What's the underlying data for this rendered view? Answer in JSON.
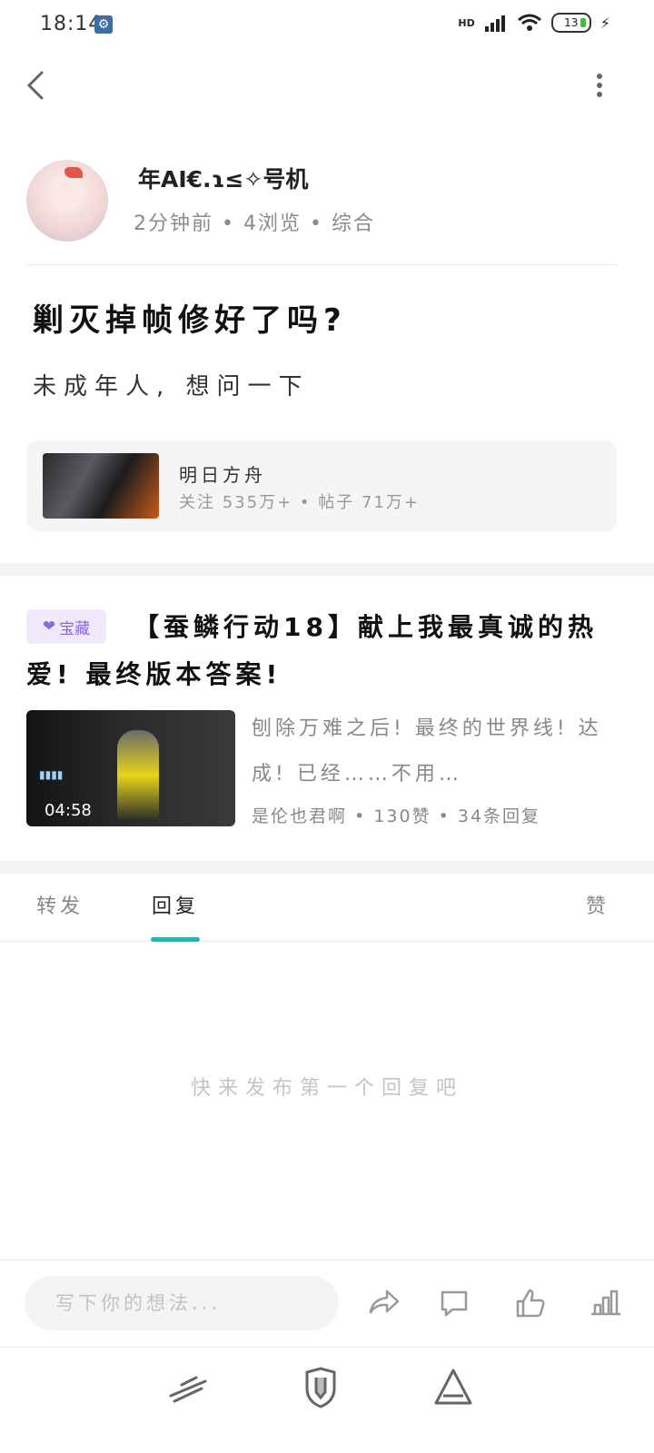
{
  "status_bar": {
    "time": "18:14",
    "network": "HD",
    "battery": "13"
  },
  "post": {
    "author": "年AI€.ɿ≤✧号机",
    "time_ago": "2分钟前",
    "views": "4浏览",
    "category": "综合",
    "title": "剿灭掉帧修好了吗?",
    "body": "未成年人, 想问一下"
  },
  "forum": {
    "name": "明日方舟",
    "followers": "关注 535万+",
    "posts": "帖子 71万+"
  },
  "related": {
    "badge": "宝藏",
    "title": "【蚕鳞行动18】献上我最真诚的热爱! 最终版本答案!",
    "summary": "刨除万难之后! 最终的世界线! 达成! 已经……不用…",
    "author": "是伦也君啊",
    "likes": "130赞",
    "replies": "34条回复",
    "thumb_timer": "04:58"
  },
  "tabs": {
    "forward": "转发",
    "reply": "回复",
    "like": "赞"
  },
  "empty_hint": "快来发布第一个回复吧",
  "comment_box": {
    "placeholder": "写下你的想法..."
  },
  "colors": {
    "accent": "#2bb3b1",
    "badge_purple": "#8a6cd8"
  }
}
